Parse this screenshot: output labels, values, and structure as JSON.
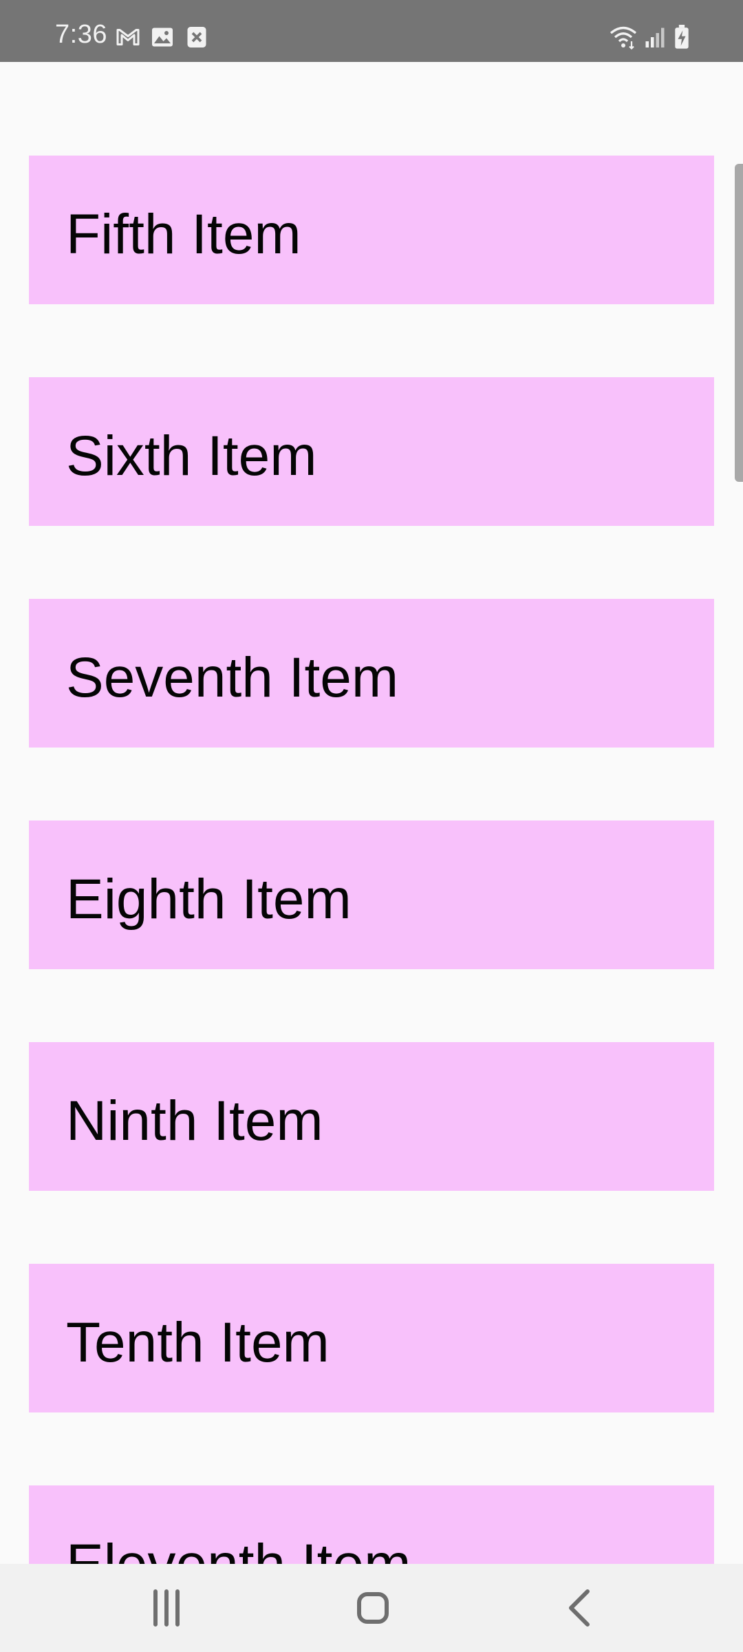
{
  "status_bar": {
    "time": "7:36",
    "notification_icons": [
      "gmail-icon",
      "gallery-icon",
      "blocked-icon"
    ],
    "system_icons": [
      "wifi-icon",
      "signal-icon",
      "battery-charging-icon"
    ]
  },
  "list": {
    "items": [
      {
        "label": "Fifth Item"
      },
      {
        "label": "Sixth Item"
      },
      {
        "label": "Seventh Item"
      },
      {
        "label": "Eighth Item"
      },
      {
        "label": "Ninth Item"
      },
      {
        "label": "Tenth Item"
      },
      {
        "label": "Eleventh Item"
      }
    ],
    "item_color": "#f8c1fb",
    "text_color": "#050505"
  },
  "nav_bar": {
    "buttons": [
      "recent-apps-icon",
      "home-icon",
      "back-icon"
    ]
  },
  "colors": {
    "status_bar": "#757575",
    "background": "#fafafa",
    "nav_bar": "#f1f1f1"
  }
}
